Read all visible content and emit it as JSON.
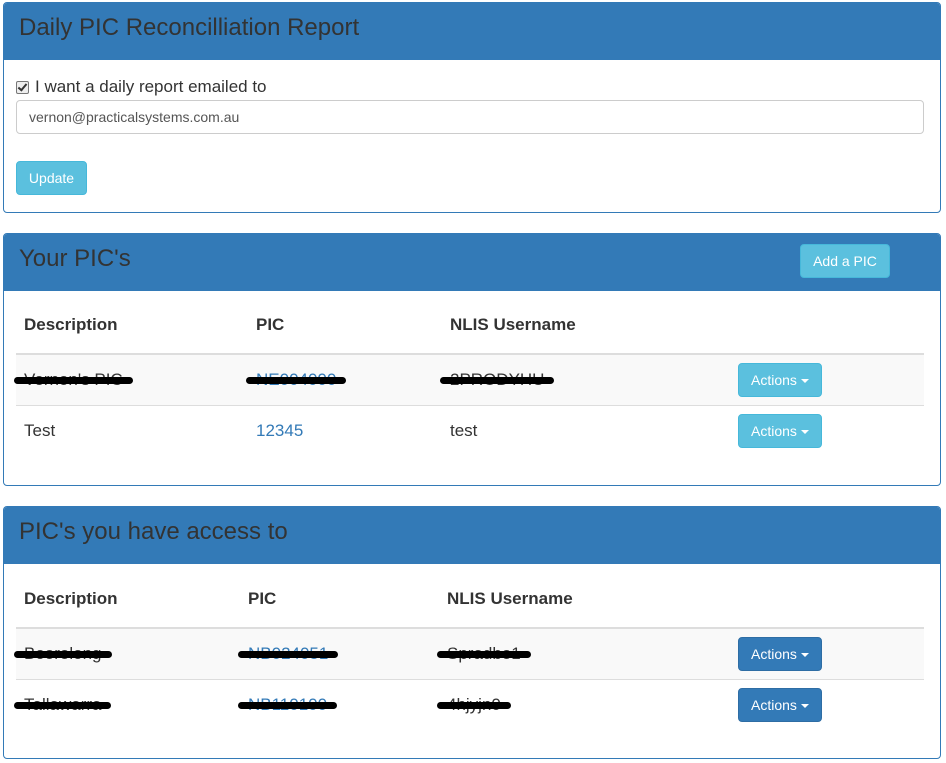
{
  "report": {
    "title": "Daily PIC Reconcilliation Report",
    "checkbox_label": "I want a daily report emailed to",
    "email": "vernon@practicalsystems.com.au",
    "update_label": "Update"
  },
  "your_pics": {
    "title": "Your PIC's",
    "add_label": "Add a PIC",
    "columns": [
      "Description",
      "PIC",
      "NLIS Username"
    ],
    "rows": [
      {
        "description": "Vernon's PIC",
        "pic": "NE004000",
        "username": "2PRODYHU",
        "actions": "Actions"
      },
      {
        "description": "Test",
        "pic": "12345",
        "username": "test",
        "actions": "Actions"
      }
    ]
  },
  "access_pics": {
    "title": "PIC's you have access to",
    "columns": [
      "Description",
      "PIC",
      "NLIS Username"
    ],
    "rows": [
      {
        "description": "Boorolong",
        "pic": "NB024051",
        "username": "Spradbo1",
        "actions": "Actions"
      },
      {
        "description": "Tallawarra",
        "pic": "NB110100",
        "username": "4hjyjn0",
        "actions": "Actions"
      }
    ]
  },
  "colors": {
    "primary": "#337ab7",
    "info": "#5bc0de"
  },
  "icons": {
    "checkbox": "checkbox-checked",
    "caret": "caret-down-icon"
  }
}
